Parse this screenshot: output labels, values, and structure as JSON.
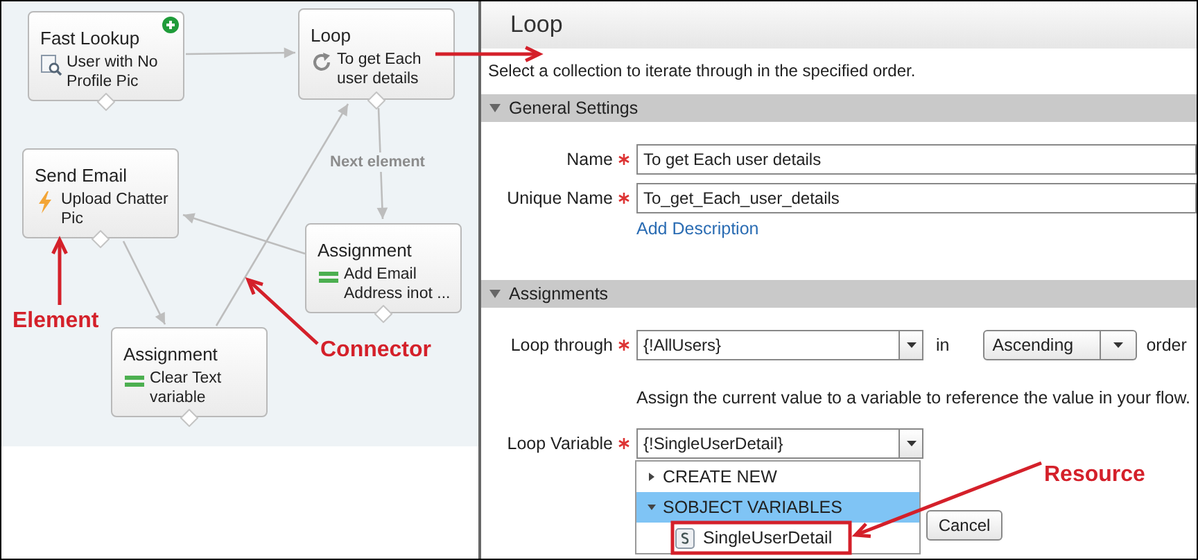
{
  "canvas": {
    "nodes": [
      {
        "kind": "lookup",
        "title": "Fast Lookup",
        "label": "User with No Profile Pic",
        "start": true
      },
      {
        "kind": "loop",
        "title": "Loop",
        "label": "To get Each user details",
        "start": false
      },
      {
        "kind": "email",
        "title": "Send Email",
        "label": "Upload Chatter Pic",
        "start": false
      },
      {
        "kind": "assignment",
        "title": "Assignment",
        "label": "Add Email Address inot ...",
        "start": false
      },
      {
        "kind": "assignment",
        "title": "Assignment",
        "label": "Clear Text variable",
        "start": false
      }
    ],
    "connector_label": "Next element"
  },
  "annotations": [
    {
      "text": "Element"
    },
    {
      "text": "Connector"
    },
    {
      "text": "Resource"
    }
  ],
  "panel": {
    "title": "Loop",
    "description": "Select a collection to iterate through in the specified order.",
    "general": {
      "title": "General Settings",
      "expanded": true,
      "name": {
        "label": "Name",
        "required": true,
        "value": "To get Each user details"
      },
      "unique_name": {
        "label": "Unique Name",
        "required": true,
        "value": "To_get_Each_user_details"
      },
      "add_description": "Add Description"
    },
    "assignments": {
      "title": "Assignments",
      "expanded": true,
      "loop_through": {
        "label": "Loop through",
        "required": true,
        "value": "{!AllUsers}"
      },
      "in_label": "in",
      "order": {
        "value": "Ascending"
      },
      "order_label": "order",
      "help": "Assign the current value to a variable to reference the value in your flow.",
      "loop_variable": {
        "label": "Loop Variable",
        "required": true,
        "value": "{!SingleUserDetail}"
      },
      "dropdown": {
        "items": [
          {
            "label": "CREATE NEW",
            "expanded": false,
            "selected": false
          },
          {
            "label": "SOBJECT VARIABLES",
            "expanded": true,
            "selected": true,
            "children": [
              {
                "label": "SingleUserDetail",
                "selected": false
              }
            ]
          }
        ]
      },
      "cancel": "Cancel"
    }
  }
}
